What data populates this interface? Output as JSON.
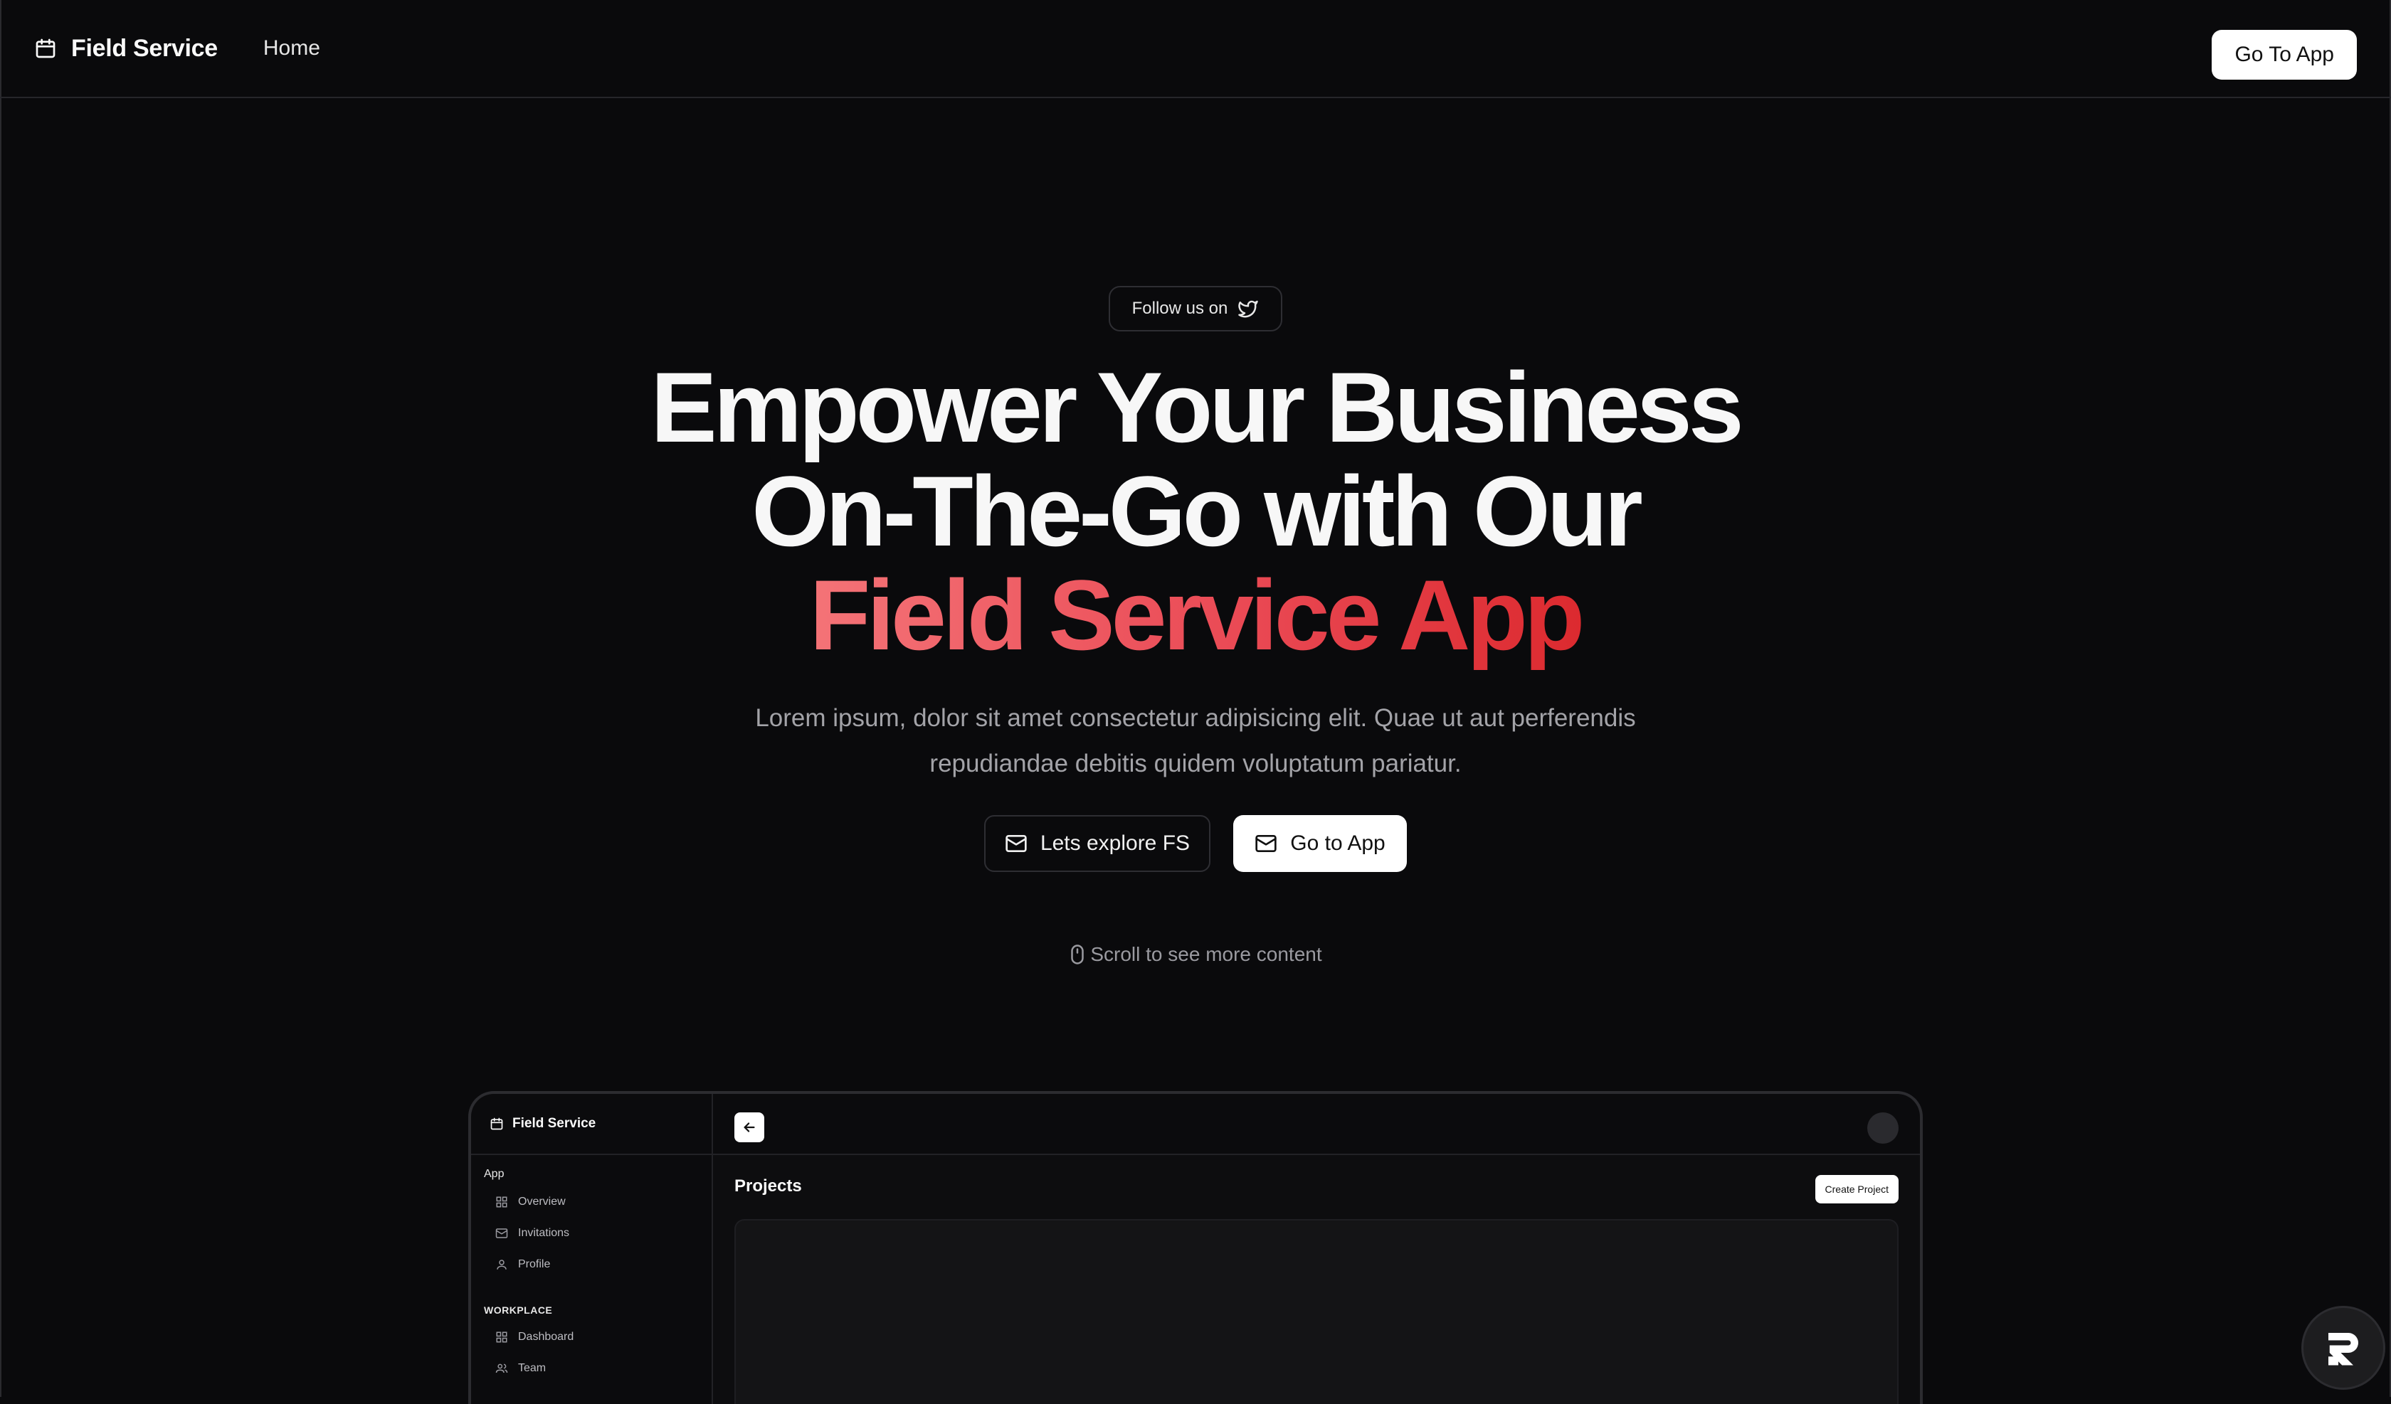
{
  "navbar": {
    "brand": "Field Service",
    "home": "Home",
    "cta": "Go To App"
  },
  "hero": {
    "follow": "Follow us on",
    "headline_line1": "Empower Your Business",
    "headline_line2": "On-The-Go with Our",
    "headline_accent": "Field Service App",
    "subtext": "Lorem ipsum, dolor sit amet consectetur adipisicing elit. Quae ut aut perferendis repudiandae debitis quidem voluptatum pariatur.",
    "primary_button": "Lets explore FS",
    "secondary_button": "Go to App",
    "scroll_hint": "Scroll to see more content"
  },
  "preview": {
    "brand": "Field Service",
    "group_app": "App",
    "app_items": [
      "Overview",
      "Invitations",
      "Profile"
    ],
    "group_workplace": "WORKPLACE",
    "workplace_items": [
      "Dashboard",
      "Team"
    ],
    "page_title": "Projects",
    "create_button": "Create Project"
  },
  "colors": {
    "background": "#0a0a0c",
    "accent_start": "#f47377",
    "accent_end": "#dc2a2f"
  }
}
